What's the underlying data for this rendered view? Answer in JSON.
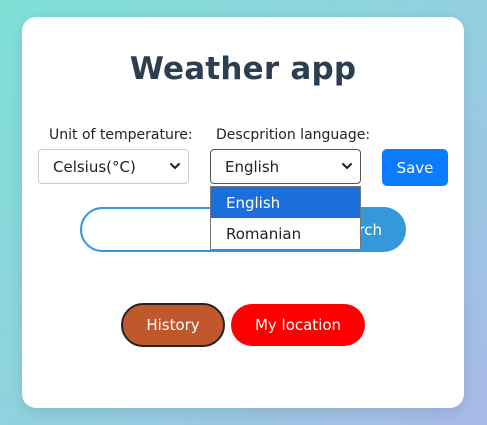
{
  "app": {
    "title": "Weather app"
  },
  "settings": {
    "unit": {
      "label": "Unit of temperature:",
      "selected": "Celsius(°C)"
    },
    "language": {
      "label": "Descprition language:",
      "selected": "English",
      "options": [
        "English",
        "Romanian"
      ]
    },
    "save_label": "Save"
  },
  "search": {
    "value": "",
    "placeholder": "",
    "button_label": "Search"
  },
  "actions": {
    "history_label": "History",
    "my_location_label": "My location"
  },
  "colors": {
    "title": "#2c3e50",
    "save": "#0d7bff",
    "search": "#3498db",
    "history": "#c1582c",
    "location": "#ff0000",
    "option_highlight": "#1a6fdc"
  },
  "icons": {
    "select_chevron": "chevron-down-icon"
  }
}
